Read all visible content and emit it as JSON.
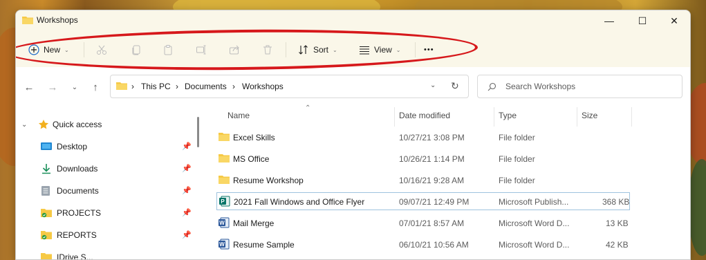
{
  "window": {
    "title": "Workshops"
  },
  "controls": {
    "minimize": "—",
    "maximize": "☐",
    "close": "✕"
  },
  "toolbar": {
    "new_label": "New",
    "sort_label": "Sort",
    "view_label": "View",
    "more_label": "•••",
    "icons": [
      "cut-icon",
      "copy-icon",
      "paste-icon",
      "rename-icon",
      "share-icon",
      "delete-icon"
    ]
  },
  "address": {
    "crumbs": [
      "This PC",
      "Documents",
      "Workshops"
    ]
  },
  "search": {
    "placeholder": "Search Workshops"
  },
  "navpane": {
    "quick_access": "Quick access",
    "items": [
      {
        "label": "Desktop",
        "icon": "desktop-icon"
      },
      {
        "label": "Downloads",
        "icon": "downloads-icon"
      },
      {
        "label": "Documents",
        "icon": "documents-icon"
      },
      {
        "label": "PROJECTS",
        "icon": "folder-icon"
      },
      {
        "label": "REPORTS",
        "icon": "folder-icon"
      },
      {
        "label": "IDrive S...",
        "icon": "folder-icon"
      }
    ]
  },
  "columns": {
    "name": "Name",
    "date": "Date modified",
    "type": "Type",
    "size": "Size"
  },
  "files": [
    {
      "name": "Excel Skills",
      "date": "10/27/21 3:08 PM",
      "type": "File folder",
      "size": "",
      "icon": "folder-icon"
    },
    {
      "name": "MS Office",
      "date": "10/26/21 1:14 PM",
      "type": "File folder",
      "size": "",
      "icon": "folder-icon"
    },
    {
      "name": "Resume Workshop",
      "date": "10/16/21 9:28 AM",
      "type": "File folder",
      "size": "",
      "icon": "folder-icon"
    },
    {
      "name": "2021 Fall Windows and Office Flyer",
      "date": "09/07/21 12:49 PM",
      "type": "Microsoft Publish...",
      "size": "368 KB",
      "icon": "publisher-icon"
    },
    {
      "name": "Mail Merge",
      "date": "07/01/21 8:57 AM",
      "type": "Microsoft Word D...",
      "size": "13 KB",
      "icon": "word-icon"
    },
    {
      "name": "Resume Sample",
      "date": "06/10/21 10:56 AM",
      "type": "Microsoft Word D...",
      "size": "42 KB",
      "icon": "word-icon"
    }
  ],
  "colors": {
    "accent_red": "#d6181b",
    "folder": "#f6c945",
    "word": "#2b579a",
    "publisher": "#077568"
  }
}
